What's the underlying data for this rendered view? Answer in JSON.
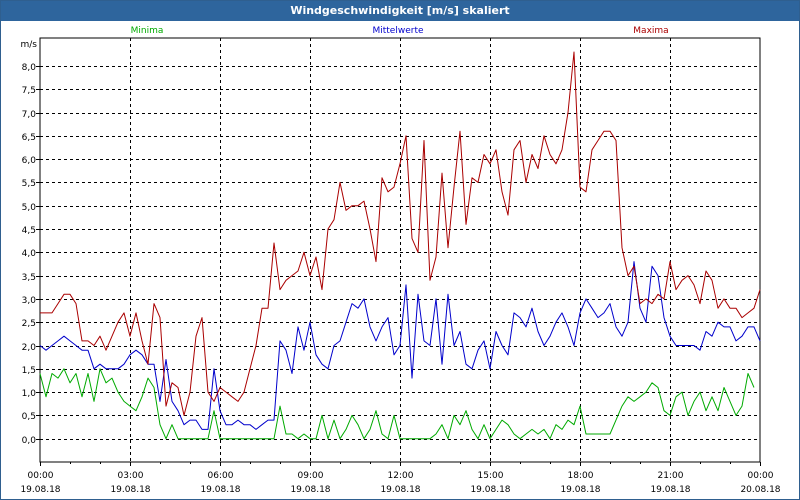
{
  "window": {
    "title": "Windgeschwindigkeit [m/s] skaliert"
  },
  "chart_data": {
    "type": "line",
    "title": "Windgeschwindigkeit [m/s] skaliert",
    "ylabel": "m/s",
    "xlabel": "",
    "ylim": [
      -0.5,
      8.6
    ],
    "xlim_hours": [
      0,
      24
    ],
    "grid": true,
    "legend_position": "top",
    "y_ticks": [
      "0,0",
      "0,5",
      "1,0",
      "1,5",
      "2,0",
      "2,5",
      "3,0",
      "3,5",
      "4,0",
      "4,5",
      "5,0",
      "5,5",
      "6,0",
      "6,5",
      "7,0",
      "7,5",
      "8,0"
    ],
    "y_tick_values": [
      0,
      0.5,
      1,
      1.5,
      2,
      2.5,
      3,
      3.5,
      4,
      4.5,
      5,
      5.5,
      6,
      6.5,
      7,
      7.5,
      8
    ],
    "x_tick_hours": [
      0,
      3,
      6,
      9,
      12,
      15,
      18,
      21,
      24
    ],
    "x_ticks_time": [
      "00:00",
      "03:00",
      "06:00",
      "09:00",
      "12:00",
      "15:00",
      "18:00",
      "21:00",
      "00:00"
    ],
    "x_ticks_date": [
      "19.08.18",
      "19.08.18",
      "19.08.18",
      "19.08.18",
      "19.08.18",
      "19.08.18",
      "19.08.18",
      "19.08.18",
      "20.08.18"
    ],
    "series": [
      {
        "name": "Minima",
        "color": "#00aa00",
        "hours": [
          0,
          0.2,
          0.4,
          0.6,
          0.8,
          1,
          1.2,
          1.4,
          1.6,
          1.8,
          2,
          2.2,
          2.4,
          2.6,
          2.8,
          3,
          3.2,
          3.4,
          3.6,
          3.8,
          4,
          4.2,
          4.4,
          4.6,
          4.8,
          5,
          5.2,
          5.4,
          5.6,
          5.8,
          6,
          6.2,
          6.4,
          6.6,
          6.8,
          7,
          7.2,
          7.4,
          7.6,
          7.8,
          8,
          8.2,
          8.4,
          8.6,
          8.8,
          9,
          9.2,
          9.4,
          9.6,
          9.8,
          10,
          10.2,
          10.4,
          10.6,
          10.8,
          11,
          11.2,
          11.4,
          11.6,
          11.8,
          12,
          12.2,
          12.4,
          12.6,
          12.8,
          13,
          13.2,
          13.4,
          13.6,
          13.8,
          14,
          14.2,
          14.4,
          14.6,
          14.8,
          15,
          15.2,
          15.4,
          15.6,
          15.8,
          16,
          16.2,
          16.4,
          16.6,
          16.8,
          17,
          17.2,
          17.4,
          17.6,
          17.8,
          18,
          18.2,
          18.4,
          18.6,
          18.8,
          19,
          19.2,
          19.4,
          19.6,
          19.8,
          20,
          20.2,
          20.4,
          20.6,
          20.8,
          21,
          21.2,
          21.4,
          21.6,
          21.8,
          22,
          22.2,
          22.4,
          22.6,
          22.8,
          23,
          23.2,
          23.4,
          23.6,
          23.8,
          24
        ],
        "values": [
          1.4,
          0.9,
          1.4,
          1.3,
          1.5,
          1.2,
          1.4,
          0.9,
          1.4,
          0.8,
          1.5,
          1.2,
          1.3,
          1.0,
          0.8,
          0.7,
          0.6,
          0.9,
          1.3,
          1.1,
          0.3,
          0.0,
          0.3,
          0.0,
          0.0,
          0.0,
          0.0,
          0.0,
          0.0,
          0.6,
          0.0,
          0.0,
          0.0,
          0.0,
          0.0,
          0.0,
          0.0,
          0.0,
          0.0,
          0.0,
          0.7,
          0.1,
          0.1,
          0.0,
          0.1,
          0.0,
          0.0,
          0.5,
          0.0,
          0.4,
          0.0,
          0.2,
          0.5,
          0.3,
          0.0,
          0.2,
          0.6,
          0.1,
          0.0,
          0.5,
          0.0,
          0.0,
          0.0,
          0.0,
          0.0,
          0.0,
          0.1,
          0.3,
          0.0,
          0.5,
          0.3,
          0.6,
          0.2,
          0.0,
          0.3,
          0.0,
          0.2,
          0.4,
          0.3,
          0.1,
          0.0,
          0.1,
          0.2,
          0.1,
          0.2,
          0.0,
          0.3,
          0.2,
          0.4,
          0.3,
          0.7,
          0.1,
          0.1,
          0.1,
          0.1,
          0.1,
          0.4,
          0.7,
          0.9,
          0.8,
          0.9,
          1.0,
          1.2,
          1.1,
          0.6,
          0.5,
          0.9,
          1.0,
          0.5,
          0.8,
          1.0,
          0.6,
          0.9,
          0.6,
          1.1,
          0.8,
          0.5,
          0.7,
          1.4,
          1.1
        ]
      },
      {
        "name": "Mittelwerte",
        "color": "#0000cc",
        "hours": [
          0,
          0.2,
          0.4,
          0.6,
          0.8,
          1,
          1.2,
          1.4,
          1.6,
          1.8,
          2,
          2.2,
          2.4,
          2.6,
          2.8,
          3,
          3.2,
          3.4,
          3.6,
          3.8,
          4,
          4.2,
          4.4,
          4.6,
          4.8,
          5,
          5.2,
          5.4,
          5.6,
          5.8,
          6,
          6.2,
          6.4,
          6.6,
          6.8,
          7,
          7.2,
          7.4,
          7.6,
          7.8,
          8,
          8.2,
          8.4,
          8.6,
          8.8,
          9,
          9.2,
          9.4,
          9.6,
          9.8,
          10,
          10.2,
          10.4,
          10.6,
          10.8,
          11,
          11.2,
          11.4,
          11.6,
          11.8,
          12,
          12.2,
          12.4,
          12.6,
          12.8,
          13,
          13.2,
          13.4,
          13.6,
          13.8,
          14,
          14.2,
          14.4,
          14.6,
          14.8,
          15,
          15.2,
          15.4,
          15.6,
          15.8,
          16,
          16.2,
          16.4,
          16.6,
          16.8,
          17,
          17.2,
          17.4,
          17.6,
          17.8,
          18,
          18.2,
          18.4,
          18.6,
          18.8,
          19,
          19.2,
          19.4,
          19.6,
          19.8,
          20,
          20.2,
          20.4,
          20.6,
          20.8,
          21,
          21.2,
          21.4,
          21.6,
          21.8,
          22,
          22.2,
          22.4,
          22.6,
          22.8,
          23,
          23.2,
          23.4,
          23.6,
          23.8,
          24
        ],
        "values": [
          2.0,
          1.9,
          2.0,
          2.1,
          2.2,
          2.1,
          2.0,
          1.9,
          1.9,
          1.5,
          1.6,
          1.5,
          1.5,
          1.5,
          1.6,
          1.8,
          1.9,
          1.8,
          1.6,
          1.6,
          0.8,
          1.7,
          0.8,
          0.6,
          0.3,
          0.4,
          0.4,
          0.2,
          0.2,
          1.5,
          0.6,
          0.3,
          0.3,
          0.4,
          0.3,
          0.3,
          0.2,
          0.3,
          0.4,
          0.4,
          2.1,
          1.9,
          1.4,
          2.4,
          1.9,
          2.5,
          1.8,
          1.6,
          1.5,
          2.0,
          2.1,
          2.5,
          2.9,
          2.8,
          3.0,
          2.4,
          2.1,
          2.4,
          2.6,
          1.8,
          2.0,
          3.3,
          1.3,
          3.1,
          2.1,
          2.0,
          3.0,
          1.6,
          3.1,
          2.0,
          2.3,
          1.6,
          1.5,
          1.9,
          2.1,
          1.5,
          2.3,
          2.0,
          1.8,
          2.7,
          2.6,
          2.4,
          2.8,
          2.3,
          2.0,
          2.2,
          2.5,
          2.7,
          2.4,
          2.0,
          2.7,
          3.0,
          2.8,
          2.6,
          2.7,
          2.9,
          2.4,
          2.2,
          2.5,
          3.8,
          2.8,
          2.5,
          3.7,
          3.5,
          2.6,
          2.2,
          2.0,
          2.0,
          2.0,
          2.0,
          1.9,
          2.3,
          2.2,
          2.5,
          2.4,
          2.4,
          2.1,
          2.2,
          2.4,
          2.4,
          2.1,
          1.9,
          1.7,
          1.9,
          2.1,
          2.3,
          2.2,
          2.5
        ]
      },
      {
        "name": "Maxima",
        "color": "#aa0000",
        "hours": [
          0,
          0.2,
          0.4,
          0.6,
          0.8,
          1,
          1.2,
          1.4,
          1.6,
          1.8,
          2,
          2.2,
          2.4,
          2.6,
          2.8,
          3,
          3.2,
          3.4,
          3.6,
          3.8,
          4,
          4.2,
          4.4,
          4.6,
          4.8,
          5,
          5.2,
          5.4,
          5.6,
          5.8,
          6,
          6.2,
          6.4,
          6.6,
          6.8,
          7,
          7.2,
          7.4,
          7.6,
          7.8,
          8,
          8.2,
          8.4,
          8.6,
          8.8,
          9,
          9.2,
          9.4,
          9.6,
          9.8,
          10,
          10.2,
          10.4,
          10.6,
          10.8,
          11,
          11.2,
          11.4,
          11.6,
          11.8,
          12,
          12.2,
          12.4,
          12.6,
          12.8,
          13,
          13.2,
          13.4,
          13.6,
          13.8,
          14,
          14.2,
          14.4,
          14.6,
          14.8,
          15,
          15.2,
          15.4,
          15.6,
          15.8,
          16,
          16.2,
          16.4,
          16.6,
          16.8,
          17,
          17.2,
          17.4,
          17.6,
          17.8,
          18,
          18.2,
          18.4,
          18.6,
          18.8,
          19,
          19.2,
          19.4,
          19.6,
          19.8,
          20,
          20.2,
          20.4,
          20.6,
          20.8,
          21,
          21.2,
          21.4,
          21.6,
          21.8,
          22,
          22.2,
          22.4,
          22.6,
          22.8,
          23,
          23.2,
          23.4,
          23.6,
          23.8,
          24
        ],
        "values": [
          2.7,
          2.7,
          2.7,
          2.9,
          3.1,
          3.1,
          2.9,
          2.1,
          2.1,
          2.0,
          2.2,
          1.9,
          2.2,
          2.5,
          2.7,
          2.2,
          2.7,
          2.1,
          1.6,
          2.9,
          2.6,
          0.7,
          1.2,
          1.1,
          0.5,
          1.0,
          2.2,
          2.6,
          1.0,
          0.8,
          1.1,
          1.0,
          0.9,
          0.8,
          1.0,
          1.5,
          2.0,
          2.8,
          2.8,
          4.2,
          3.2,
          3.4,
          3.5,
          3.6,
          4.0,
          3.5,
          3.9,
          3.2,
          4.5,
          4.7,
          5.5,
          4.9,
          5.0,
          5.0,
          5.1,
          4.5,
          3.8,
          5.6,
          5.3,
          5.4,
          5.9,
          6.5,
          4.3,
          4.0,
          6.4,
          3.4,
          3.9,
          5.7,
          4.1,
          5.4,
          6.6,
          4.6,
          5.6,
          5.5,
          6.1,
          5.9,
          6.2,
          5.3,
          4.8,
          6.2,
          6.4,
          5.5,
          6.1,
          5.8,
          6.5,
          6.1,
          5.9,
          6.2,
          7.0,
          8.3,
          5.4,
          5.3,
          6.2,
          6.4,
          6.6,
          6.6,
          6.4,
          4.1,
          3.5,
          3.7,
          2.9,
          3.0,
          2.9,
          3.1,
          3.0,
          3.8,
          3.2,
          3.4,
          3.5,
          3.3,
          2.9,
          3.6,
          3.4,
          2.8,
          3.0,
          2.8,
          2.8,
          2.6,
          2.7,
          2.8,
          3.2,
          4.2,
          3.7,
          3.7,
          4.0
        ]
      }
    ]
  }
}
